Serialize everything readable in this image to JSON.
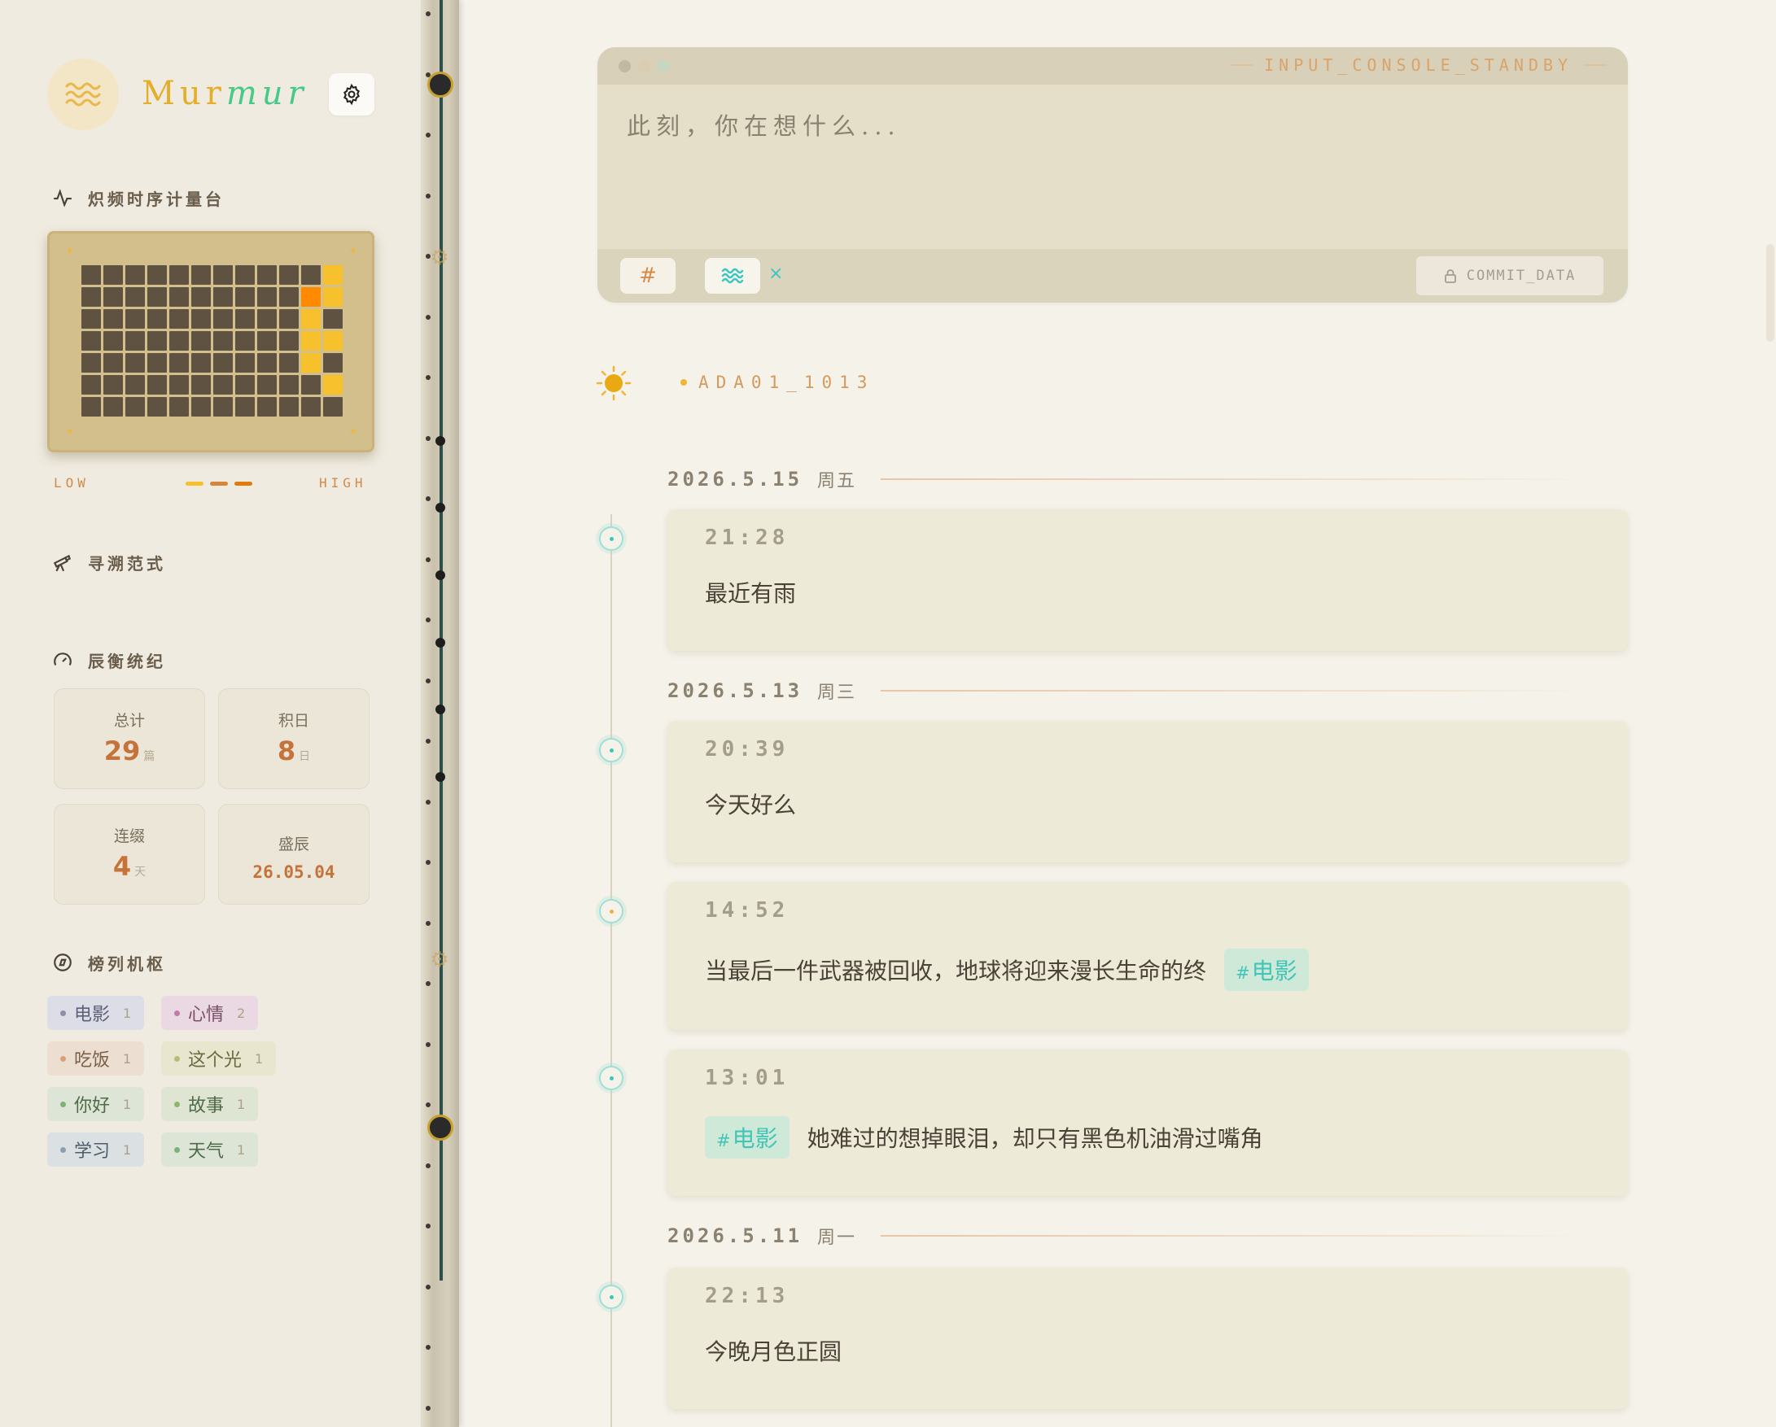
{
  "app": {
    "logo_part1": "Mur",
    "logo_part2": "mur"
  },
  "sidebar": {
    "heatmap_title": "炽频时序计量台",
    "legend_low": "LOW",
    "legend_high": "HIGH",
    "legend_colors": [
      "#f6c12c",
      "#d4873a",
      "#e07b10"
    ],
    "heatmap_levels": [
      [
        0,
        0,
        0,
        0,
        0,
        0,
        0,
        0,
        0,
        0,
        0,
        1
      ],
      [
        0,
        0,
        0,
        0,
        0,
        0,
        0,
        0,
        0,
        0,
        2,
        1
      ],
      [
        0,
        0,
        0,
        0,
        0,
        0,
        0,
        0,
        0,
        0,
        1,
        0
      ],
      [
        0,
        0,
        0,
        0,
        0,
        0,
        0,
        0,
        0,
        0,
        1,
        1
      ],
      [
        0,
        0,
        0,
        0,
        0,
        0,
        0,
        0,
        0,
        0,
        1,
        0
      ],
      [
        0,
        0,
        0,
        0,
        0,
        0,
        0,
        0,
        0,
        0,
        0,
        1
      ],
      [
        0,
        0,
        0,
        0,
        0,
        0,
        0,
        0,
        0,
        0,
        0,
        0
      ]
    ],
    "explore_title": "寻溯范式",
    "stats_title": "辰衡统纪",
    "stats": {
      "total": {
        "label": "总计",
        "value": "29",
        "unit": "篇"
      },
      "days": {
        "label": "积日",
        "value": "8",
        "unit": "日"
      },
      "streak": {
        "label": "连缀",
        "value": "4",
        "unit": "天"
      },
      "peak": {
        "label": "盛辰",
        "value": "26.05.04"
      }
    },
    "tags_title": "榜列机枢",
    "tags": [
      {
        "name": "电影",
        "count": "1",
        "bg": "#dcdde6",
        "fg": "#5c6078",
        "dot": "#8b90a8"
      },
      {
        "name": "心情",
        "count": "2",
        "bg": "#ead9e3",
        "fg": "#7a4d68",
        "dot": "#c47aa6"
      },
      {
        "name": "吃饭",
        "count": "1",
        "bg": "#ecdfd2",
        "fg": "#7a6048",
        "dot": "#d8a07a"
      },
      {
        "name": "这个光",
        "count": "1",
        "bg": "#e8e6cf",
        "fg": "#6a6a40",
        "dot": "#b8b97a"
      },
      {
        "name": "你好",
        "count": "1",
        "bg": "#dde6d6",
        "fg": "#4e6a48",
        "dot": "#7db07a"
      },
      {
        "name": "故事",
        "count": "1",
        "bg": "#dfe5d3",
        "fg": "#4e6a48",
        "dot": "#8fb56a"
      },
      {
        "name": "学习",
        "count": "1",
        "bg": "#dbe0e3",
        "fg": "#4e5e6a",
        "dot": "#8aa0b0"
      },
      {
        "name": "天气",
        "count": "1",
        "bg": "#dde6d6",
        "fg": "#4e6a48",
        "dot": "#7db07a"
      }
    ]
  },
  "console": {
    "status": "INPUT_CONSOLE_STANDBY",
    "placeholder": "此刻，你在想什么...",
    "hash_label": "#",
    "clear_label": "×",
    "commit_label": "COMMIT_DATA"
  },
  "user": {
    "name": "ADA01_1013"
  },
  "timeline": {
    "groups": [
      {
        "date": "2026.5.15",
        "weekday": "周五",
        "entries": [
          {
            "time": "21:28",
            "text": "最近有雨"
          }
        ]
      },
      {
        "date": "2026.5.13",
        "weekday": "周三",
        "entries": [
          {
            "time": "20:39",
            "text": "今天好么"
          },
          {
            "time": "14:52",
            "text": "当最后一件武器被回收，地球将迎来漫长生命的终",
            "tag": "电影"
          },
          {
            "time": "13:01",
            "tag": "电影",
            "text": "她难过的想掉眼泪，却只有黑色机油滑过嘴角"
          }
        ]
      },
      {
        "date": "2026.5.11",
        "weekday": "周一",
        "entries": [
          {
            "time": "22:13",
            "text": "今晚月色正圆"
          }
        ]
      }
    ]
  }
}
